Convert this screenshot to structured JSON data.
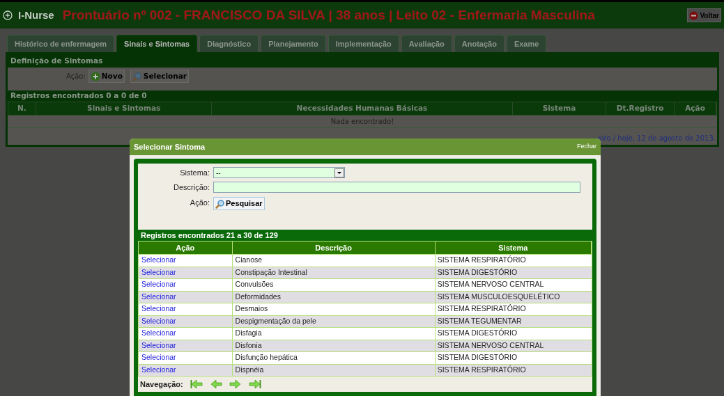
{
  "header": {
    "logo": "I-Nurse",
    "title": "Prontuário nº 002 - FRANCISCO DA SILVA | 38 anos | Leito 02 - Enfermaria Masculina",
    "back_button": "Voltar"
  },
  "tabs": [
    {
      "label": "Histórico de enfermagem",
      "selected": false
    },
    {
      "label": "Sinais e Sintomas",
      "selected": true
    },
    {
      "label": "Diagnóstico",
      "selected": false
    },
    {
      "label": "Planejamento",
      "selected": false
    },
    {
      "label": "Implementação",
      "selected": false
    },
    {
      "label": "Avaliação",
      "selected": false
    },
    {
      "label": "Anotação",
      "selected": false
    },
    {
      "label": "Exame",
      "selected": false
    }
  ],
  "definition": {
    "title": "Definição de Sintomas",
    "action_label": "Ação:",
    "buttons": [
      {
        "kind": "new",
        "label": "Novo"
      },
      {
        "kind": "search",
        "label": "Selecionar"
      }
    ]
  },
  "records": {
    "summary": "Registros encontrados 0 a 0 de 0",
    "columns": [
      "N.",
      "Sinais e Sintomas",
      "Necessidades Humanas Básicas",
      "Sistema",
      "Dt.Registro",
      "Ação"
    ],
    "empty_message": "Nada encontrado!"
  },
  "footer_text": "eiro / hoje, 12 de agosto de 2013.",
  "dialog": {
    "title": "Selecionar Sintoma",
    "close": "Fechar",
    "fields": [
      {
        "kind": "select",
        "label": "Sistema:",
        "value": "--"
      },
      {
        "kind": "text",
        "label": "Descrição:"
      }
    ],
    "action_label": "Ação:",
    "search_button": "Pesquisar",
    "summary": "Registros encontrados 21 a 30 de 129",
    "columns": [
      "Ação",
      "Descrição",
      "Sistema"
    ],
    "rows": [
      {
        "action": "Selecionar",
        "description": "Cianose",
        "system": "SISTEMA RESPIRATÓRIO"
      },
      {
        "action": "Selecionar",
        "description": "Constipação Intestinal",
        "system": "SISTEMA DIGESTÓRIO"
      },
      {
        "action": "Selecionar",
        "description": "Convulsões",
        "system": "SISTEMA NERVOSO CENTRAL"
      },
      {
        "action": "Selecionar",
        "description": "Deformidades",
        "system": "SISTEMA MUSCULOESQUELÉTICO"
      },
      {
        "action": "Selecionar",
        "description": "Desmaios",
        "system": "SISTEMA RESPIRATÓRIO"
      },
      {
        "action": "Selecionar",
        "description": "Despigmentação da pele",
        "system": "SISTEMA TEGUMENTAR"
      },
      {
        "action": "Selecionar",
        "description": "Disfagia",
        "system": "SISTEMA DIGESTÓRIO"
      },
      {
        "action": "Selecionar",
        "description": "Disfonia",
        "system": "SISTEMA NERVOSO CENTRAL"
      },
      {
        "action": "Selecionar",
        "description": "Disfunção hepática",
        "system": "SISTEMA DIGESTÓRIO"
      },
      {
        "action": "Selecionar",
        "description": "Dispnéia",
        "system": "SISTEMA RESPIRATÓRIO"
      }
    ],
    "navigation_label": "Navegação:"
  }
}
